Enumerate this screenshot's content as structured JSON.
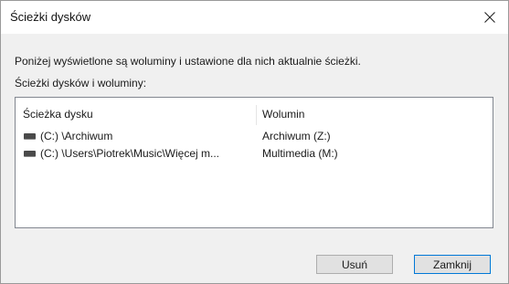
{
  "dialog": {
    "title": "Ścieżki dysków",
    "description": "Poniżej wyświetlone są woluminy i ustawione dla nich aktualnie ścieżki.",
    "list_label": "Ścieżki dysków i woluminy:"
  },
  "table": {
    "columns": [
      "Ścieżka dysku",
      "Wolumin"
    ],
    "rows": [
      {
        "icon": "drive-icon",
        "path": "(C:) \\Archiwum",
        "volume": "Archiwum (Z:)"
      },
      {
        "icon": "drive-icon",
        "path": "(C:) \\Users\\Piotrek\\Music\\Więcej m...",
        "volume": "Multimedia (M:)"
      }
    ]
  },
  "buttons": {
    "remove": "Usuń",
    "close": "Zamknij"
  },
  "icons": {
    "close": "close-icon",
    "drive": "drive-icon"
  }
}
